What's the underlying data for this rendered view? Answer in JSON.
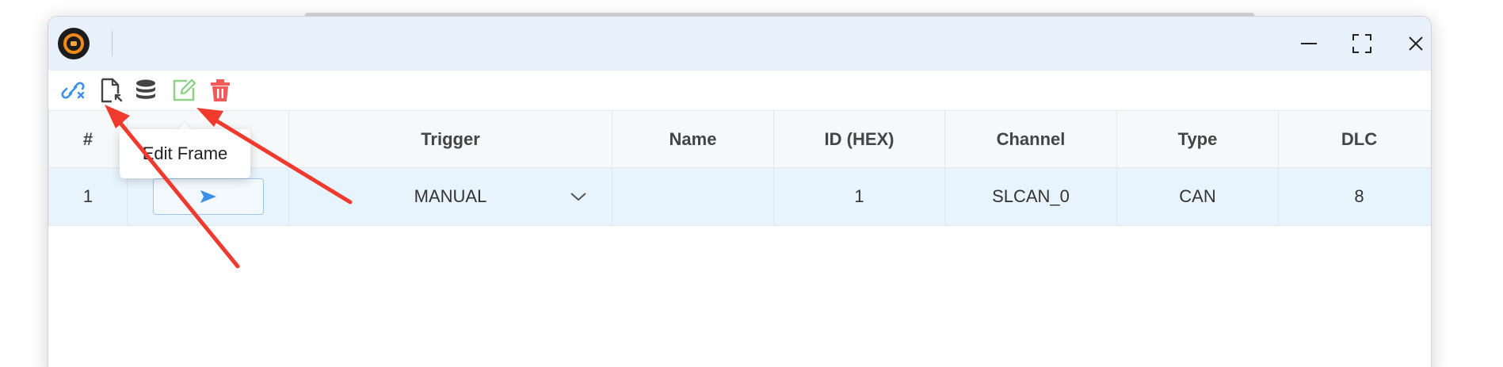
{
  "window": {
    "logo_icon": "app-logo-icon",
    "controls": [
      {
        "name": "minimize",
        "icon": "minimize-icon"
      },
      {
        "name": "maximize",
        "icon": "fullscreen-icon"
      },
      {
        "name": "close",
        "icon": "close-icon"
      }
    ]
  },
  "toolbar": {
    "buttons": [
      {
        "icon": "link-disconnect-icon",
        "color": "#3b8fe8"
      },
      {
        "icon": "file-import-icon",
        "color": "#444444"
      },
      {
        "icon": "database-icon",
        "color": "#444444"
      },
      {
        "icon": "edit-icon",
        "color": "#8fd18a"
      },
      {
        "icon": "trash-icon",
        "color": "#f05a5a"
      }
    ]
  },
  "tooltip": {
    "text": "Edit Frame"
  },
  "table": {
    "columns": [
      "#",
      "",
      "Trigger",
      "Name",
      "ID (HEX)",
      "Channel",
      "Type",
      "DLC"
    ],
    "rows": [
      {
        "index": "1",
        "send_icon": "send-icon",
        "trigger": "MANUAL",
        "name": "",
        "id_hex": "1",
        "channel": "SLCAN_0",
        "type": "CAN",
        "dlc": "8"
      }
    ]
  },
  "colors": {
    "titlebar": "#e8f1fb",
    "row_selected": "#e8f4fd",
    "accent": "#3b8fe8",
    "annotation_arrow": "#f03a2e"
  }
}
